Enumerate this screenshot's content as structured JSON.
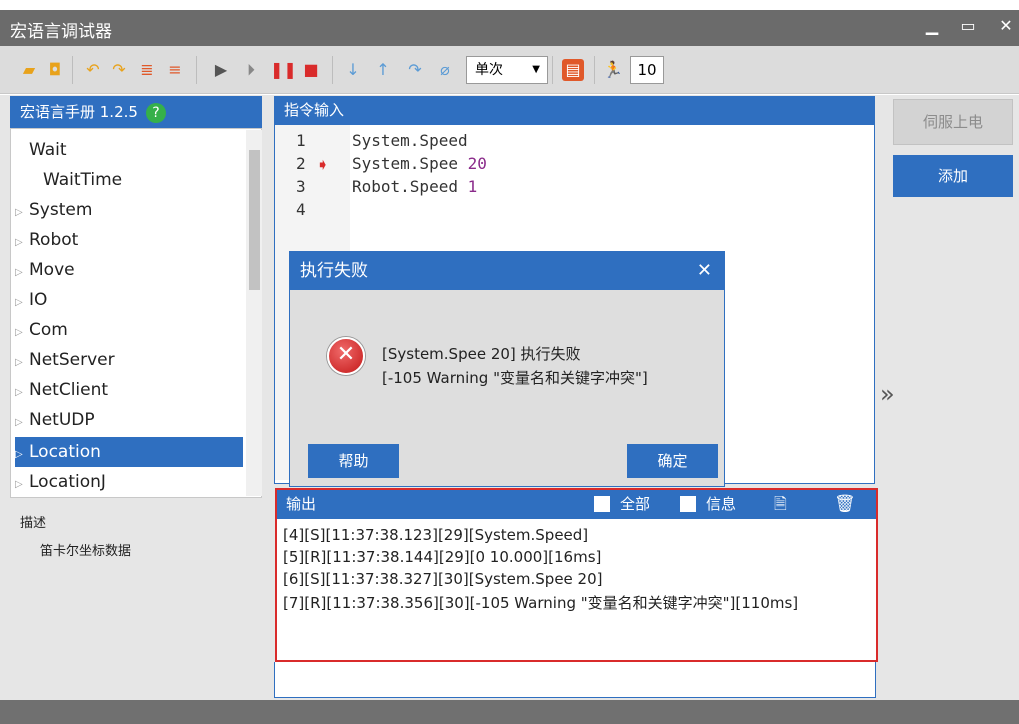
{
  "window": {
    "title": "宏语言调试器",
    "min": "▁",
    "max": "▭",
    "close": "✕"
  },
  "toolbar": {
    "mode": "单次",
    "count": "10"
  },
  "manual": {
    "title": "宏语言手册 1.2.5",
    "help": "?"
  },
  "tree": [
    {
      "label": "Wait",
      "arrow": ""
    },
    {
      "label": "WaitTime",
      "arrow": ""
    },
    {
      "label": "System",
      "arrow": "▷"
    },
    {
      "label": "Robot",
      "arrow": "▷"
    },
    {
      "label": "Move",
      "arrow": "▷"
    },
    {
      "label": "IO",
      "arrow": "▷"
    },
    {
      "label": "Com",
      "arrow": "▷"
    },
    {
      "label": "NetServer",
      "arrow": "▷"
    },
    {
      "label": "NetClient",
      "arrow": "▷"
    },
    {
      "label": "NetUDP",
      "arrow": "▷"
    },
    {
      "label": "Location",
      "arrow": "▷"
    },
    {
      "label": "LocationJ",
      "arrow": "▷"
    }
  ],
  "desc": {
    "title": "描述",
    "text": "笛卡尔坐标数据"
  },
  "editor": {
    "title": "指令输入",
    "lines": [
      {
        "no": "1",
        "code": "System.Speed",
        "arg": ""
      },
      {
        "no": "2",
        "code": "System.Spee ",
        "arg": "20"
      },
      {
        "no": "3",
        "code": "Robot.Speed ",
        "arg": "1"
      },
      {
        "no": "4",
        "code": "",
        "arg": ""
      }
    ]
  },
  "output": {
    "title": "输出",
    "all": "全部",
    "info": "信息",
    "lines": [
      "[4][S][11:37:38.123][29][System.Speed]",
      "[5][R][11:37:38.144][29][0 10.000][16ms]",
      "[6][S][11:37:38.327][30][System.Spee 20]",
      "[7][R][11:37:38.356][30][-105 Warning \"变量名和关键字冲突\"][110ms]"
    ]
  },
  "right": {
    "servo": "伺服上电",
    "add": "添加",
    "expand": "»"
  },
  "dialog": {
    "title": "执行失败",
    "close": "✕",
    "msg1": "[System.Spee 20] 执行失败",
    "msg2": "[-105 Warning \"变量名和关键字冲突\"]",
    "help": "帮助",
    "ok": "确定"
  },
  "colors": {
    "accent": "#2f6fc0",
    "error": "#d92b2b"
  }
}
